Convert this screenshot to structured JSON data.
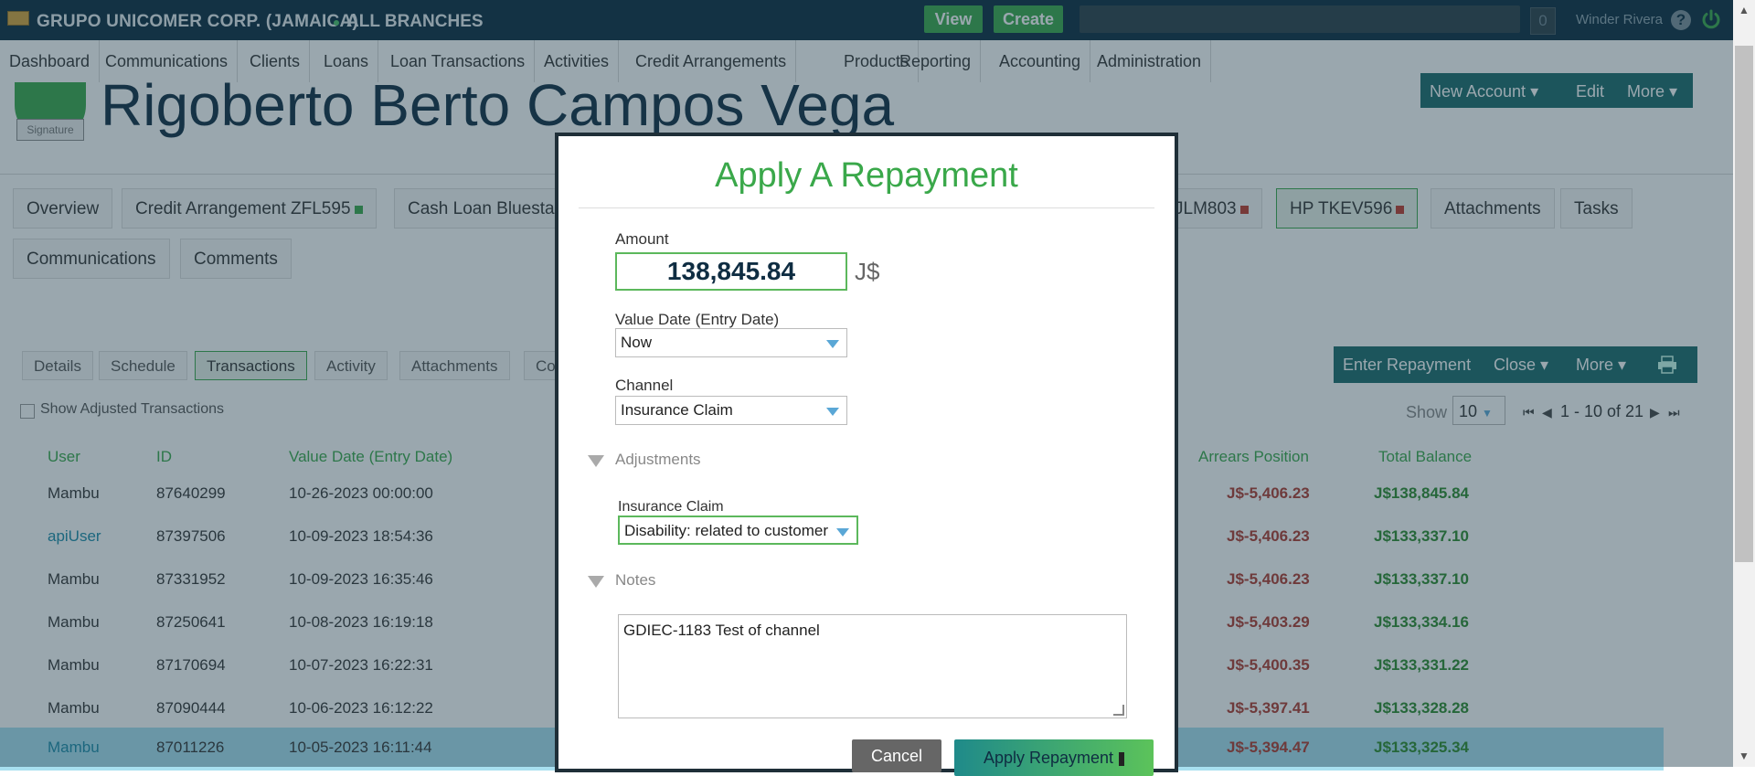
{
  "topbar": {
    "company": "GRUPO UNICOMER CORP. (JAMAICA)",
    "branch": "ALL BRANCHES",
    "view_label": "View",
    "create_label": "Create",
    "notification_count": "0",
    "user_name": "Winder Rivera",
    "help_glyph": "?"
  },
  "nav": {
    "items": [
      "Dashboard",
      "Communications",
      "Clients",
      "Loans",
      "Loan Transactions",
      "Activities",
      "Credit Arrangements",
      "Products",
      "Reporting",
      "Accounting",
      "Administration"
    ]
  },
  "client": {
    "avatar_label": "Signature",
    "name": "Rigoberto Berto Campos Vega",
    "actions": [
      "New Account",
      "Edit",
      "More"
    ]
  },
  "account_tabs": {
    "row1": [
      "Overview",
      "Credit Arrangement ZFL595",
      "Cash Loan Bluesta",
      "JLM803",
      "HP TKEV596",
      "Attachments",
      "Tasks"
    ],
    "row2": [
      "Communications",
      "Comments"
    ]
  },
  "sub_tabs": [
    "Details",
    "Schedule",
    "Transactions",
    "Activity",
    "Attachments",
    "Co"
  ],
  "action_bar": {
    "enter_repayment": "Enter Repayment",
    "close": "Close",
    "more": "More"
  },
  "filters": {
    "show_adjusted": "Show Adjusted Transactions",
    "show_label": "Show",
    "page_size": "10",
    "pager_text": "1 - 10 of 21"
  },
  "table": {
    "headers": {
      "user": "User",
      "id": "ID",
      "value_date": "Value Date (Entry Date)",
      "arrears": "Arrears Position",
      "balance": "Total Balance"
    },
    "rows": [
      {
        "user": "Mambu",
        "id": "87640299",
        "date": "10-26-2023 00:00:00",
        "arrears": "J$-5,406.23",
        "balance": "J$138,845.84"
      },
      {
        "user": "apiUser",
        "id": "87397506",
        "date": "10-09-2023 18:54:36",
        "arrears": "J$-5,406.23",
        "balance": "J$133,337.10"
      },
      {
        "user": "Mambu",
        "id": "87331952",
        "date": "10-09-2023 16:35:46",
        "arrears": "J$-5,406.23",
        "balance": "J$133,337.10"
      },
      {
        "user": "Mambu",
        "id": "87250641",
        "date": "10-08-2023 16:19:18",
        "arrears": "J$-5,403.29",
        "balance": "J$133,334.16"
      },
      {
        "user": "Mambu",
        "id": "87170694",
        "date": "10-07-2023 16:22:31",
        "arrears": "J$-5,400.35",
        "balance": "J$133,331.22"
      },
      {
        "user": "Mambu",
        "id": "87090444",
        "date": "10-06-2023 16:12:22",
        "arrears": "J$-5,397.41",
        "balance": "J$133,328.28"
      },
      {
        "user": "Mambu",
        "id": "87011226",
        "date": "10-05-2023 16:11:44",
        "arrears": "J$-5,394.47",
        "balance": "J$133,325.34"
      }
    ]
  },
  "modal": {
    "title": "Apply A Repayment",
    "amount_label": "Amount",
    "amount_value": "138,845.84",
    "currency": "J$",
    "value_date_label": "Value Date (Entry Date)",
    "value_date_value": "Now",
    "channel_label": "Channel",
    "channel_value": "Insurance Claim",
    "adjustments_label": "Adjustments",
    "insurance_claim_label": "Insurance Claim",
    "insurance_claim_value": "Disability: related to customer",
    "notes_label": "Notes",
    "notes_value": "GDIEC-1183 Test of channel",
    "cancel_label": "Cancel",
    "apply_label": "Apply Repayment"
  }
}
